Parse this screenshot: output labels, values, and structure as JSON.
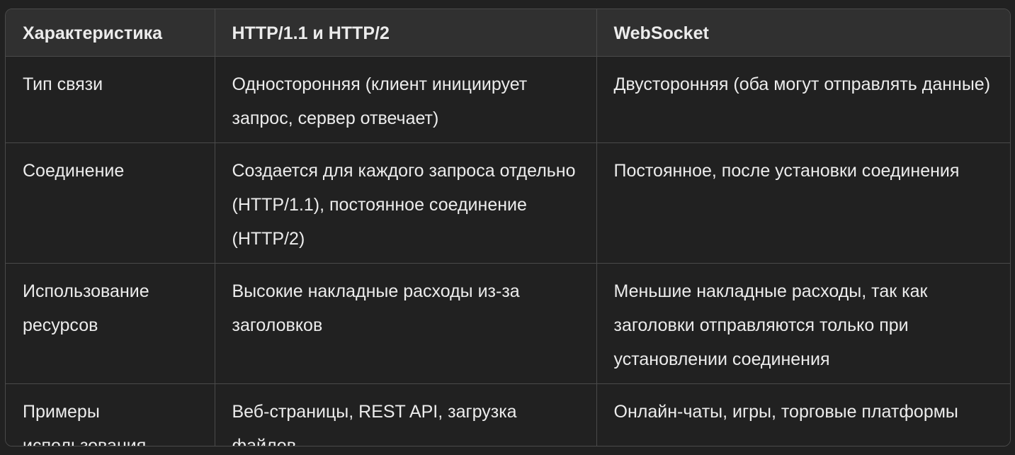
{
  "table": {
    "headers": [
      "Характеристика",
      "HTTP/1.1 и HTTP/2",
      "WebSocket"
    ],
    "rows": [
      [
        "Тип связи",
        "Односторонняя (клиент инициирует запрос, сервер отвечает)",
        "Двусторонняя (оба могут отправлять данные)"
      ],
      [
        "Соединение",
        "Создается для каждого запроса отдельно (HTTP/1.1), постоянное соединение (HTTP/2)",
        "Постоянное, после установки соединения"
      ],
      [
        "Использование ресурсов",
        "Высокие накладные расходы из-за заголовков",
        "Меньшие накладные расходы, так как заголовки отправляются только при установлении соединения"
      ],
      [
        "Примеры использования",
        "Веб-страницы, REST API, загрузка файлов",
        "Онлайн-чаты, игры, торговые платформы"
      ]
    ]
  },
  "colors": {
    "background": "#212121",
    "header_background": "#303030",
    "border": "#4a4a4a",
    "text": "#ececec"
  }
}
